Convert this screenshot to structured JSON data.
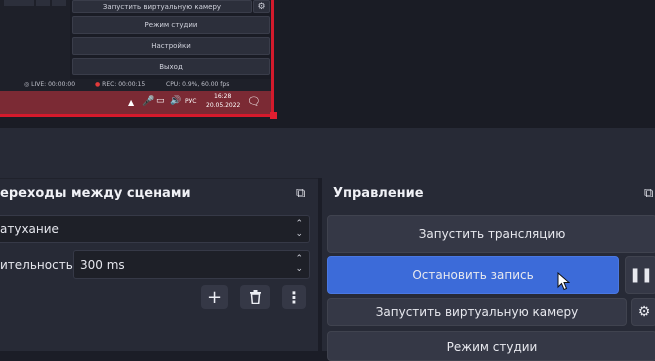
{
  "preview": {
    "menu_buttons": [
      "Запустить виртуальную камеру",
      "Режим студии",
      "Настройки",
      "Выход"
    ],
    "status": {
      "live": "LIVE: 00:00:00",
      "rec": "REC: 00:00:15",
      "cpu": "CPU: 0.9%, 60.00 fps"
    },
    "taskbar": {
      "lang": "РУС",
      "time": "16:28",
      "date": "20.05.2022"
    }
  },
  "transitions": {
    "title": "ереходы между сценами",
    "transition_value": "атухание",
    "duration_label": "ительность",
    "duration_value": "300 ms"
  },
  "controls": {
    "title": "Управление",
    "start_stream": "Запустить трансляцию",
    "stop_record": "Остановить запись",
    "start_virtualcam": "Запустить виртуальную камеру",
    "studio_mode": "Режим студии"
  }
}
